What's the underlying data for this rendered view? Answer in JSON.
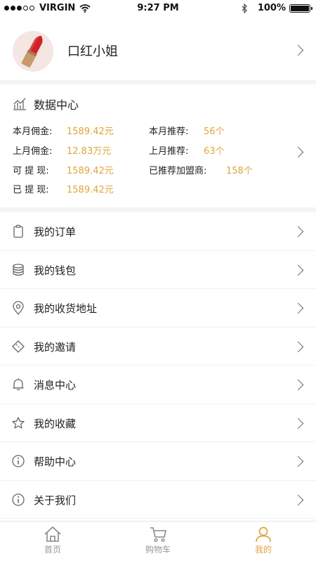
{
  "status_bar": {
    "carrier": "VIRGIN",
    "time": "9:27 PM",
    "battery": "100%",
    "battery_level": 1.0
  },
  "profile": {
    "nickname": "口红小姐"
  },
  "data_center": {
    "title": "数据中心",
    "left": [
      {
        "label": "本月佣金:",
        "value": "1589.42元"
      },
      {
        "label": "上月佣金:",
        "value": "12.83万元"
      },
      {
        "label": "可 提 现:",
        "value": "1589.42元"
      },
      {
        "label": "已 提 现:",
        "value": "1589.42元"
      }
    ],
    "right": [
      {
        "label": "本月推荐:",
        "value": "56个"
      },
      {
        "label": "上月推荐:",
        "value": "63个"
      },
      {
        "label": "已推荐加盟商:",
        "value": "158个"
      }
    ]
  },
  "menu": [
    {
      "label": "我的订单",
      "icon": "clipboard-icon"
    },
    {
      "label": "我的钱包",
      "icon": "coins-icon"
    },
    {
      "label": "我的收货地址",
      "icon": "location-pin-icon"
    },
    {
      "label": "我的邀请",
      "icon": "ticket-icon"
    },
    {
      "label": "消息中心",
      "icon": "bell-icon"
    },
    {
      "label": "我的收藏",
      "icon": "star-icon"
    },
    {
      "label": "帮助中心",
      "icon": "info-icon"
    },
    {
      "label": "关于我们",
      "icon": "info-icon"
    }
  ],
  "tabbar": [
    {
      "label": "首页",
      "icon": "home-icon",
      "active": false
    },
    {
      "label": "购物车",
      "icon": "cart-icon",
      "active": false
    },
    {
      "label": "我的",
      "icon": "user-icon",
      "active": true
    }
  ],
  "colors": {
    "accent": "#e0a53c",
    "text": "#222222",
    "divider": "#f4f4f4"
  }
}
